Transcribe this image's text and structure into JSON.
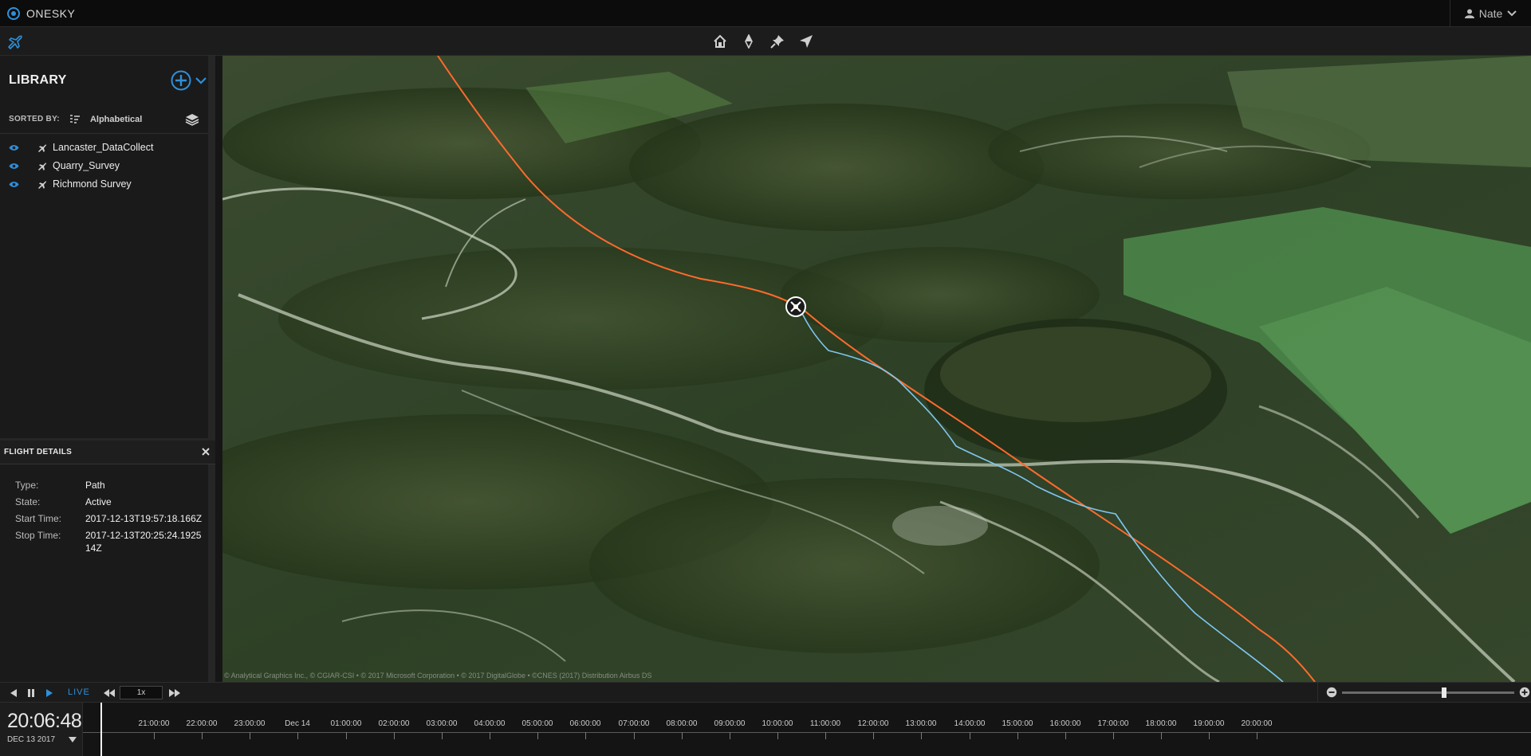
{
  "app": {
    "name": "ONESKY",
    "user": "Nate"
  },
  "toolbar": {
    "tools": [
      "home-icon",
      "compass-icon",
      "pin-icon",
      "navigate-icon"
    ]
  },
  "library": {
    "title": "LIBRARY",
    "sorted_by_label": "SORTED BY:",
    "sort_value": "Alphabetical",
    "items": [
      {
        "label": "Lancaster_DataCollect"
      },
      {
        "label": "Quarry_Survey"
      },
      {
        "label": "Richmond Survey"
      }
    ]
  },
  "flight_details": {
    "title": "FLIGHT DETAILS",
    "rows": [
      {
        "key": "Type:",
        "value": "Path"
      },
      {
        "key": "State:",
        "value": "Active"
      },
      {
        "key": "Start Time:",
        "value": "2017-12-13T19:57:18.166Z"
      },
      {
        "key": "Stop Time:",
        "value": "2017-12-13T20:25:24.192514Z"
      }
    ]
  },
  "map": {
    "attribution": "© Analytical Graphics Inc., © CGIAR-CSI • © 2017 Microsoft Corporation • © 2017 DigitalGlobe • ©CNES (2017) Distribution Airbus DS",
    "colors": {
      "planned_path": "#ff6a2c",
      "actual_path": "#7fc6f0"
    }
  },
  "playback": {
    "live_label": "LIVE",
    "speed": "1x"
  },
  "timeline": {
    "clock_time": "20:06:48",
    "clock_date": "DEC 13 2017",
    "labels": [
      "21:00:00",
      "22:00:00",
      "23:00:00",
      "Dec 14",
      "01:00:00",
      "02:00:00",
      "03:00:00",
      "04:00:00",
      "05:00:00",
      "06:00:00",
      "07:00:00",
      "08:00:00",
      "09:00:00",
      "10:00:00",
      "11:00:00",
      "12:00:00",
      "13:00:00",
      "14:00:00",
      "15:00:00",
      "16:00:00",
      "17:00:00",
      "18:00:00",
      "19:00:00",
      "20:00:00"
    ]
  },
  "theme": {
    "accent": "#2f8fd8"
  }
}
